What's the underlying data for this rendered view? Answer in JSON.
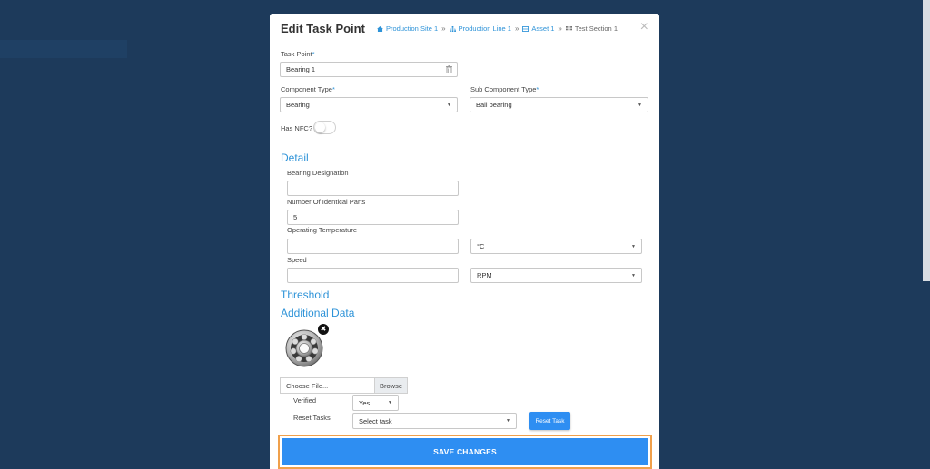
{
  "modal": {
    "title": "Edit Task Point",
    "breadcrumb": [
      {
        "label": "Production Site 1",
        "icon": "home-icon"
      },
      {
        "label": "Production Line 1",
        "icon": "sitemap-icon"
      },
      {
        "label": "Asset 1",
        "icon": "asset-icon"
      },
      {
        "label": "Test Section 1",
        "icon": "grid-icon"
      }
    ],
    "breadcrumb_separator": "»",
    "close_label": "×"
  },
  "form": {
    "task_point_label": "Task Point",
    "task_point_value": "Bearing 1",
    "component_type_label": "Component Type",
    "component_type_value": "Bearing",
    "sub_component_type_label": "Sub Component Type",
    "sub_component_type_value": "Ball bearing",
    "has_nfc_label": "Has NFC?",
    "has_nfc_on": false,
    "required_mark": "*"
  },
  "detail": {
    "heading": "Detail",
    "bearing_designation_label": "Bearing Designation",
    "bearing_designation_value": "",
    "identical_parts_label": "Number Of Identical Parts",
    "identical_parts_value": "5",
    "operating_temp_label": "Operating Temperature",
    "operating_temp_value": "",
    "operating_temp_unit": "°C",
    "speed_label": "Speed",
    "speed_value": "",
    "speed_unit": "RPM"
  },
  "threshold": {
    "heading": "Threshold"
  },
  "additional": {
    "heading": "Additional Data",
    "remove_label": "✖",
    "choose_file": "Choose File...",
    "browse": "Browse",
    "verified_label": "Verified",
    "verified_value": "Yes",
    "reset_tasks_label": "Reset Tasks",
    "reset_tasks_placeholder": "Select task",
    "reset_task_button": "Reset Task"
  },
  "footer": {
    "save_label": "SAVE CHANGES"
  },
  "colors": {
    "accent": "#2e8ef2",
    "link": "#2e93d8",
    "highlight": "#f0a04b",
    "backdrop": "#1d3a5b"
  }
}
